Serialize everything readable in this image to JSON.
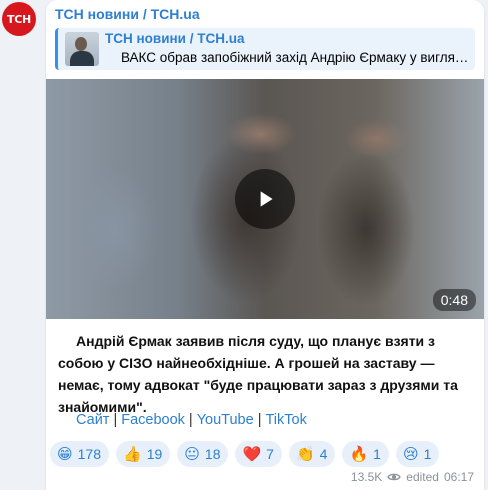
{
  "channel": {
    "avatar_text": "ТСН",
    "name": "ТСН новини / TCH.ua"
  },
  "reply": {
    "title": "ТСН новини / TCH.ua",
    "text": "ВАКС обрав запобіжний захід Андрію Єрмаку у вигляді застави"
  },
  "video": {
    "duration": "0:48"
  },
  "message": {
    "text": "Андрій Єрмак заявив після суду, що планує взяти з собою у СІЗО найнеобхідніше. А грошей на заставу — немає, тому адвокат \"буде працювати зараз з друзями та знайомими\"."
  },
  "links": [
    {
      "label": "Сайт"
    },
    {
      "label": "Facebook"
    },
    {
      "label": "YouTube"
    },
    {
      "label": "TikTok"
    }
  ],
  "link_separator": "|",
  "reactions": [
    {
      "emoji": "😁",
      "count": "178"
    },
    {
      "emoji": "👍",
      "count": "19"
    },
    {
      "emoji": "😐",
      "count": "18"
    },
    {
      "emoji": "❤️",
      "count": "7"
    },
    {
      "emoji": "👏",
      "count": "4"
    },
    {
      "emoji": "🔥",
      "count": "1"
    },
    {
      "emoji": "😢",
      "count": "1"
    }
  ],
  "meta": {
    "views": "13.5K",
    "edited": "edited",
    "time": "06:17"
  },
  "colors": {
    "accent": "#2d7fcf",
    "avatar_bg": "#d6171e",
    "reaction_bg": "#e7f0fa"
  }
}
